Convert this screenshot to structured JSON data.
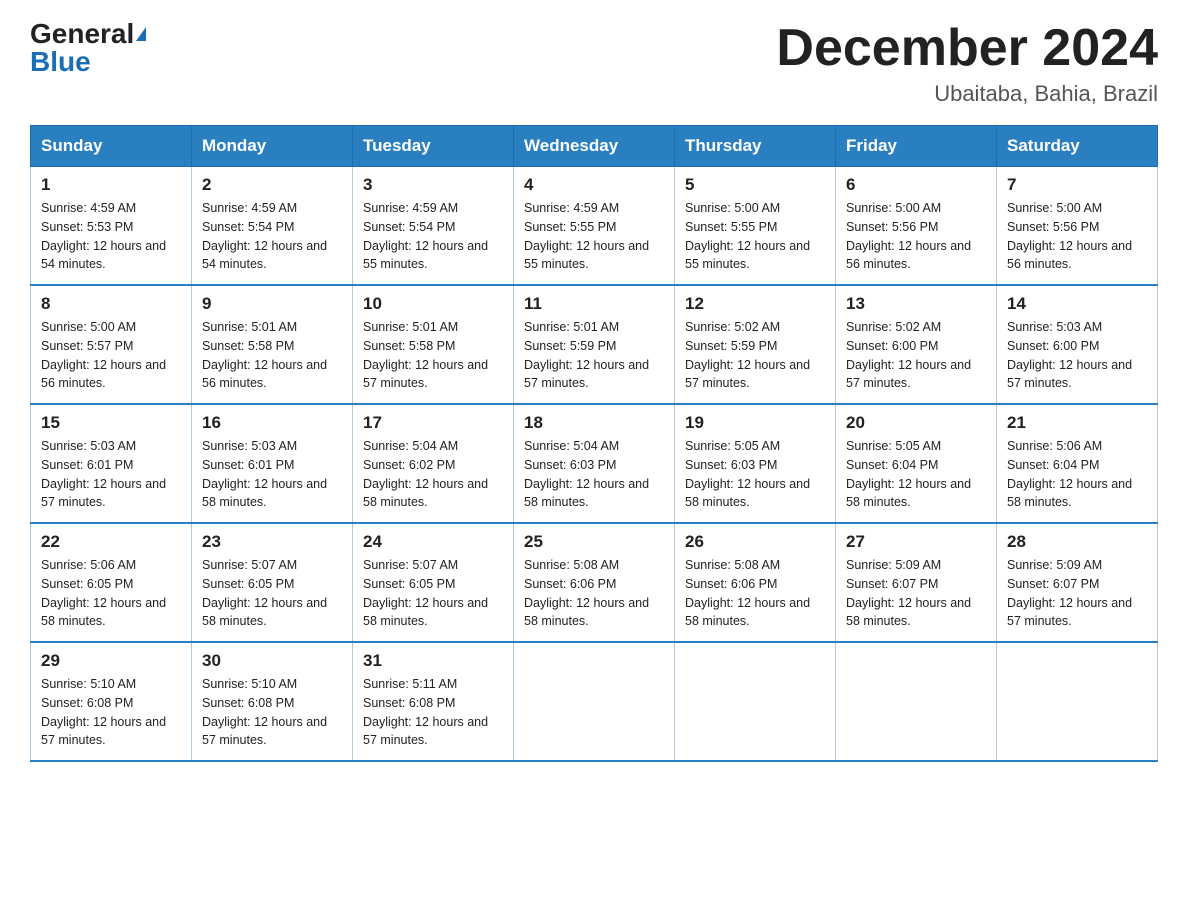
{
  "header": {
    "logo_general": "General",
    "logo_blue": "Blue",
    "month_title": "December 2024",
    "location": "Ubaitaba, Bahia, Brazil"
  },
  "days_of_week": [
    "Sunday",
    "Monday",
    "Tuesday",
    "Wednesday",
    "Thursday",
    "Friday",
    "Saturday"
  ],
  "weeks": [
    [
      {
        "num": "1",
        "sunrise": "4:59 AM",
        "sunset": "5:53 PM",
        "daylight": "12 hours and 54 minutes."
      },
      {
        "num": "2",
        "sunrise": "4:59 AM",
        "sunset": "5:54 PM",
        "daylight": "12 hours and 54 minutes."
      },
      {
        "num": "3",
        "sunrise": "4:59 AM",
        "sunset": "5:54 PM",
        "daylight": "12 hours and 55 minutes."
      },
      {
        "num": "4",
        "sunrise": "4:59 AM",
        "sunset": "5:55 PM",
        "daylight": "12 hours and 55 minutes."
      },
      {
        "num": "5",
        "sunrise": "5:00 AM",
        "sunset": "5:55 PM",
        "daylight": "12 hours and 55 minutes."
      },
      {
        "num": "6",
        "sunrise": "5:00 AM",
        "sunset": "5:56 PM",
        "daylight": "12 hours and 56 minutes."
      },
      {
        "num": "7",
        "sunrise": "5:00 AM",
        "sunset": "5:56 PM",
        "daylight": "12 hours and 56 minutes."
      }
    ],
    [
      {
        "num": "8",
        "sunrise": "5:00 AM",
        "sunset": "5:57 PM",
        "daylight": "12 hours and 56 minutes."
      },
      {
        "num": "9",
        "sunrise": "5:01 AM",
        "sunset": "5:58 PM",
        "daylight": "12 hours and 56 minutes."
      },
      {
        "num": "10",
        "sunrise": "5:01 AM",
        "sunset": "5:58 PM",
        "daylight": "12 hours and 57 minutes."
      },
      {
        "num": "11",
        "sunrise": "5:01 AM",
        "sunset": "5:59 PM",
        "daylight": "12 hours and 57 minutes."
      },
      {
        "num": "12",
        "sunrise": "5:02 AM",
        "sunset": "5:59 PM",
        "daylight": "12 hours and 57 minutes."
      },
      {
        "num": "13",
        "sunrise": "5:02 AM",
        "sunset": "6:00 PM",
        "daylight": "12 hours and 57 minutes."
      },
      {
        "num": "14",
        "sunrise": "5:03 AM",
        "sunset": "6:00 PM",
        "daylight": "12 hours and 57 minutes."
      }
    ],
    [
      {
        "num": "15",
        "sunrise": "5:03 AM",
        "sunset": "6:01 PM",
        "daylight": "12 hours and 57 minutes."
      },
      {
        "num": "16",
        "sunrise": "5:03 AM",
        "sunset": "6:01 PM",
        "daylight": "12 hours and 58 minutes."
      },
      {
        "num": "17",
        "sunrise": "5:04 AM",
        "sunset": "6:02 PM",
        "daylight": "12 hours and 58 minutes."
      },
      {
        "num": "18",
        "sunrise": "5:04 AM",
        "sunset": "6:03 PM",
        "daylight": "12 hours and 58 minutes."
      },
      {
        "num": "19",
        "sunrise": "5:05 AM",
        "sunset": "6:03 PM",
        "daylight": "12 hours and 58 minutes."
      },
      {
        "num": "20",
        "sunrise": "5:05 AM",
        "sunset": "6:04 PM",
        "daylight": "12 hours and 58 minutes."
      },
      {
        "num": "21",
        "sunrise": "5:06 AM",
        "sunset": "6:04 PM",
        "daylight": "12 hours and 58 minutes."
      }
    ],
    [
      {
        "num": "22",
        "sunrise": "5:06 AM",
        "sunset": "6:05 PM",
        "daylight": "12 hours and 58 minutes."
      },
      {
        "num": "23",
        "sunrise": "5:07 AM",
        "sunset": "6:05 PM",
        "daylight": "12 hours and 58 minutes."
      },
      {
        "num": "24",
        "sunrise": "5:07 AM",
        "sunset": "6:05 PM",
        "daylight": "12 hours and 58 minutes."
      },
      {
        "num": "25",
        "sunrise": "5:08 AM",
        "sunset": "6:06 PM",
        "daylight": "12 hours and 58 minutes."
      },
      {
        "num": "26",
        "sunrise": "5:08 AM",
        "sunset": "6:06 PM",
        "daylight": "12 hours and 58 minutes."
      },
      {
        "num": "27",
        "sunrise": "5:09 AM",
        "sunset": "6:07 PM",
        "daylight": "12 hours and 58 minutes."
      },
      {
        "num": "28",
        "sunrise": "5:09 AM",
        "sunset": "6:07 PM",
        "daylight": "12 hours and 57 minutes."
      }
    ],
    [
      {
        "num": "29",
        "sunrise": "5:10 AM",
        "sunset": "6:08 PM",
        "daylight": "12 hours and 57 minutes."
      },
      {
        "num": "30",
        "sunrise": "5:10 AM",
        "sunset": "6:08 PM",
        "daylight": "12 hours and 57 minutes."
      },
      {
        "num": "31",
        "sunrise": "5:11 AM",
        "sunset": "6:08 PM",
        "daylight": "12 hours and 57 minutes."
      },
      null,
      null,
      null,
      null
    ]
  ]
}
